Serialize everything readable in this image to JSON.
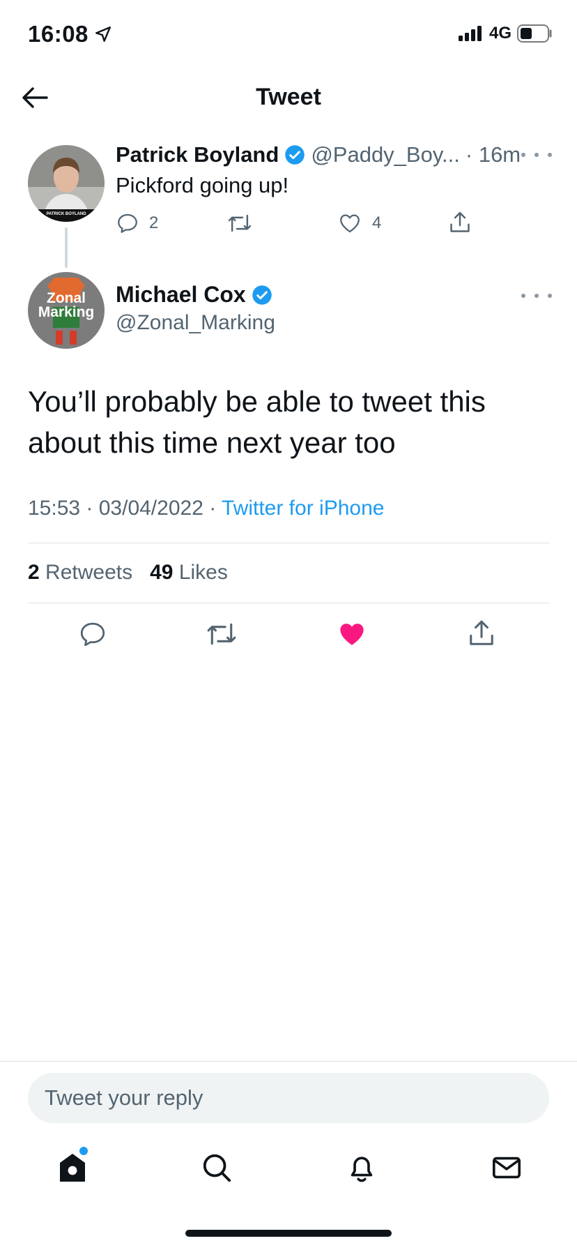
{
  "status_bar": {
    "time": "16:08",
    "network": "4G"
  },
  "header": {
    "title": "Tweet"
  },
  "parent_tweet": {
    "name": "Patrick Boyland",
    "handle": "@Paddy_Boy...",
    "time": "· 16m",
    "text": "Pickford going up!",
    "reply_count": "2",
    "like_count": "4",
    "avatar_caption": "PATRICK BOYLAND"
  },
  "main_tweet": {
    "name": "Michael Cox",
    "handle": "@Zonal_Marking",
    "avatar_text_1": "Zonal",
    "avatar_text_2": "Marking",
    "text": "You’ll probably be able to tweet this about this time next year too",
    "timestamp": "15:53 · 03/04/2022 · ",
    "source": "Twitter for iPhone",
    "retweet_count": "2",
    "retweet_label": "Retweets",
    "like_count": "49",
    "like_label": "Likes"
  },
  "reply": {
    "placeholder": "Tweet your reply"
  },
  "colors": {
    "accent": "#1d9bf0",
    "like_active": "#f91880",
    "secondary_text": "#536471"
  }
}
